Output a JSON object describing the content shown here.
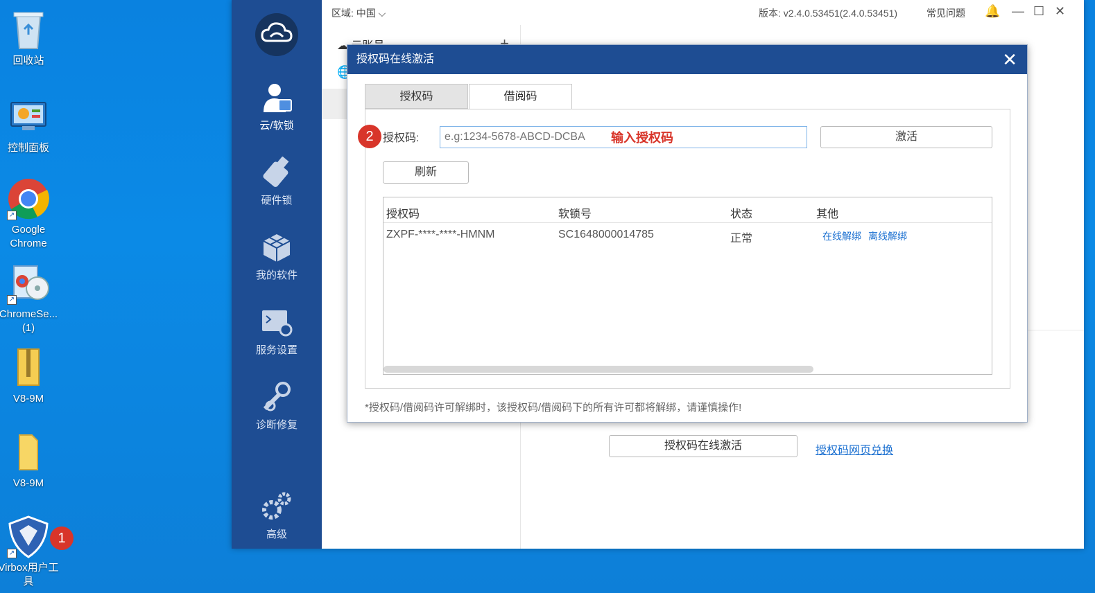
{
  "desktop": {
    "icons": [
      {
        "label": "回收站"
      },
      {
        "label": "控制面板"
      },
      {
        "label": "Google Chrome"
      },
      {
        "label": "ChromeSe... (1)"
      },
      {
        "label": "V8-9M"
      },
      {
        "label": "V8-9M"
      },
      {
        "label": "Virbox用户工具"
      }
    ],
    "step1_badge": "1"
  },
  "app": {
    "sidebar": {
      "items": [
        {
          "label": "云/软锁",
          "icon": "user-card-icon"
        },
        {
          "label": "硬件锁",
          "icon": "usb-key-icon"
        },
        {
          "label": "我的软件",
          "icon": "cubes-icon"
        },
        {
          "label": "服务设置",
          "icon": "terminal-gear-icon"
        },
        {
          "label": "诊断修复",
          "icon": "tools-icon"
        },
        {
          "label": "高级",
          "icon": "gears-icon"
        }
      ]
    },
    "topbar": {
      "region_label": "区域:",
      "region_value": "中国",
      "version": "版本: v2.4.0.53451(2.4.0.53451)",
      "faq": "常见问题"
    },
    "list": {
      "item1": "云账号"
    },
    "background_button": "授权码在线激活",
    "background_link": "授权码网页兑换"
  },
  "dialog": {
    "title": "授权码在线激活",
    "tabs": [
      "授权码",
      "借阅码"
    ],
    "step2_badge": "2",
    "code_label": "授权码:",
    "code_placeholder": "e.g:1234-5678-ABCD-DCBA",
    "code_hint": "输入授权码",
    "activate_button": "激活",
    "refresh_button": "刷新",
    "table": {
      "headers": [
        "授权码",
        "软锁号",
        "状态",
        "其他"
      ],
      "rows": [
        {
          "code": "ZXPF-****-****-HMNM",
          "lock": "SC1648000014785",
          "status": "正常",
          "online_unbind": "在线解绑",
          "offline_unbind": "离线解绑"
        }
      ]
    },
    "note": "*授权码/借阅码许可解绑时，该授权码/借阅码下的所有许可都将解绑，请谨慎操作!"
  }
}
